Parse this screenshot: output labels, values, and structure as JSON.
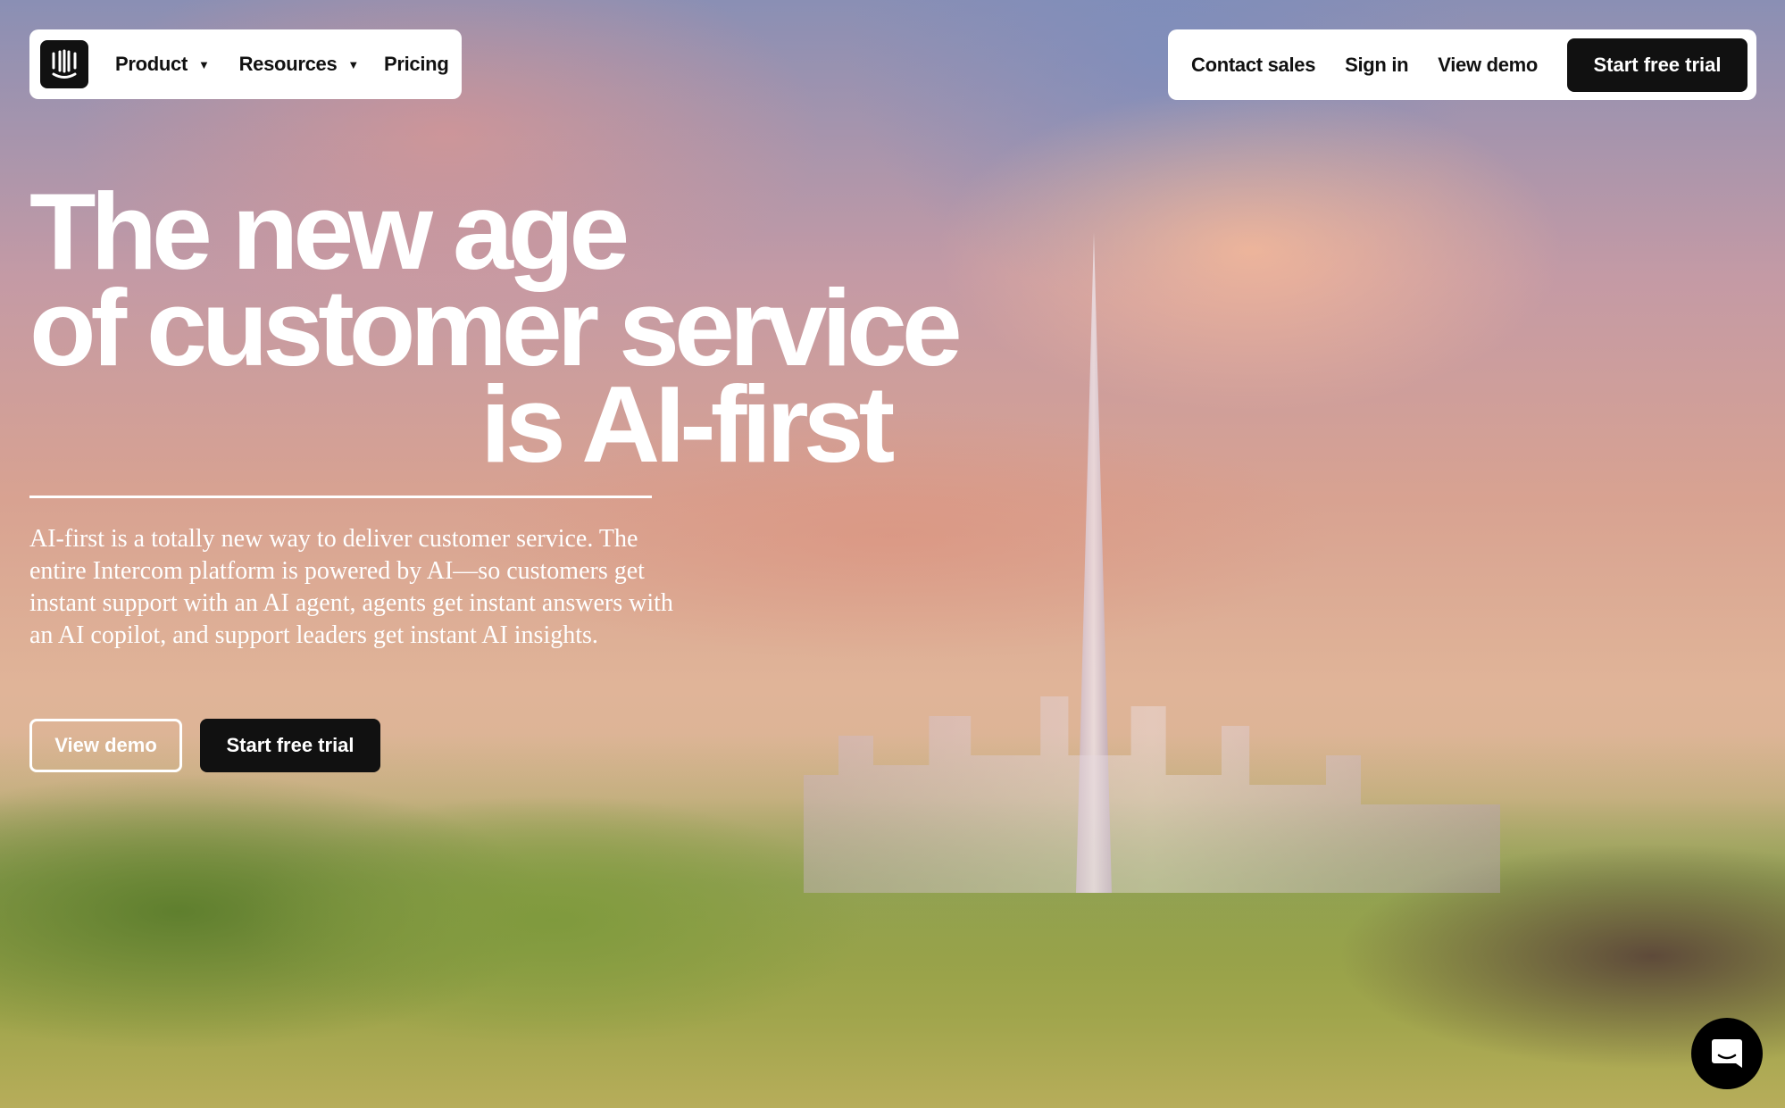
{
  "nav": {
    "logo": "Intercom",
    "product": "Product",
    "resources": "Resources",
    "pricing": "Pricing",
    "contact_sales": "Contact sales",
    "sign_in": "Sign in",
    "view_demo": "View demo",
    "start_trial": "Start free trial"
  },
  "hero": {
    "line1": "The new age",
    "line2": "of customer service",
    "line3": "is AI-first",
    "description": "AI-first is a totally new way to deliver customer service. The entire Intercom platform is powered by AI—so customers get instant support with an AI agent, agents get instant answers with an AI copilot, and support leaders get instant AI insights.",
    "view_demo": "View demo",
    "start_trial": "Start free trial"
  },
  "icons": {
    "logo": "intercom-logo-icon",
    "caret": "caret-down-icon",
    "chat": "chat-messenger-icon"
  }
}
